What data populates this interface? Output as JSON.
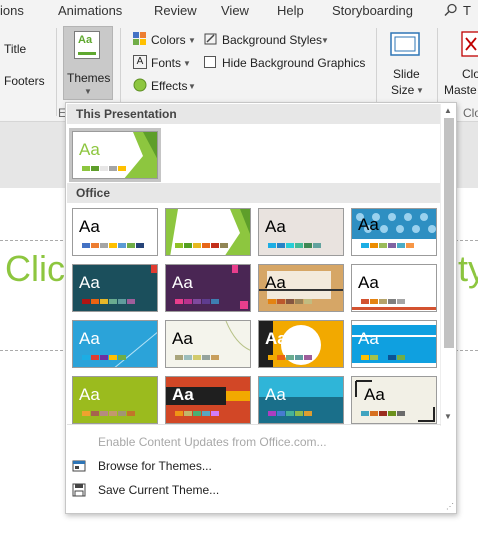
{
  "tabs": [
    "ions",
    "Animations",
    "Review",
    "View",
    "Help",
    "Storyboarding",
    "T"
  ],
  "ribbon": {
    "left_items": [
      "Title",
      "Footers",
      "E"
    ],
    "themes_label": "Themes",
    "colors_label": "Colors",
    "fonts_label": "Fonts",
    "effects_label": "Effects",
    "bg_styles_label": "Background Styles",
    "hide_bg_label": "Hide Background Graphics",
    "slide_size_line1": "Slide",
    "slide_size_line2": "Size",
    "right_line1": "Clo",
    "right_line2": "Maste",
    "right_line3": "Clo"
  },
  "slide": {
    "title_left": "Clic",
    "title_right": "ty"
  },
  "gallery": {
    "section_this": "This Presentation",
    "section_office": "Office",
    "themes": [
      {
        "aa": "Aa"
      },
      {
        "aa": "Aa"
      },
      {
        "aa": "Aa"
      },
      {
        "aa": "Aa"
      },
      {
        "aa": "Aa"
      },
      {
        "aa": "Aa"
      },
      {
        "aa": "Aa"
      },
      {
        "aa": "Aa"
      },
      {
        "aa": "Aa"
      },
      {
        "aa": "Aa"
      },
      {
        "aa": "Aa"
      },
      {
        "aa": "Aa"
      },
      {
        "aa": "Aa"
      },
      {
        "aa": "Aa"
      },
      {
        "aa": "Aa"
      },
      {
        "aa": "Aa"
      },
      {
        "aa": "Aa"
      }
    ],
    "menu": {
      "enable_updates": "Enable Content Updates from Office.com...",
      "browse": "Browse for Themes...",
      "save": "Save Current Theme..."
    }
  },
  "colors": {
    "accent_green": "#8dc63f",
    "selected_highlight": "#c5c5c5"
  }
}
